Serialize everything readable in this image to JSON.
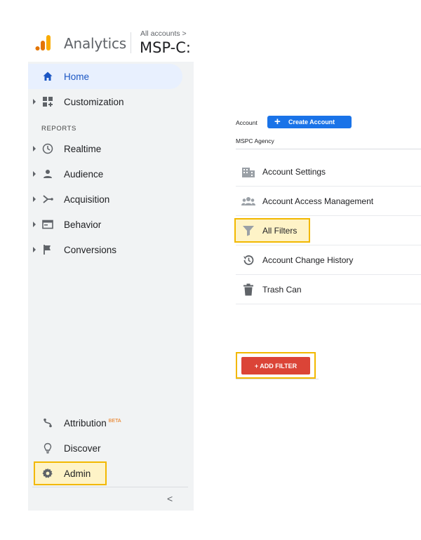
{
  "header": {
    "app_title": "Analytics",
    "breadcrumb": "All accounts >",
    "property_name": "MSP-C: I"
  },
  "sidebar": {
    "home": "Home",
    "customization": "Customization",
    "reports_section": "REPORTS",
    "realtime": "Realtime",
    "audience": "Audience",
    "acquisition": "Acquisition",
    "behavior": "Behavior",
    "conversions": "Conversions",
    "attribution": "Attribution",
    "attribution_badge": "BETA",
    "discover": "Discover",
    "admin": "Admin",
    "collapse_glyph": "<"
  },
  "admin": {
    "account_label": "Account",
    "create_account": "Create Account",
    "create_plus": "+",
    "account_value": "MSPC Agency",
    "menu": [
      {
        "label": "Account Settings",
        "icon": "building-icon"
      },
      {
        "label": "Account Access Management",
        "icon": "people-icon"
      },
      {
        "label": "All Filters",
        "icon": "funnel-icon"
      },
      {
        "label": "Account Change History",
        "icon": "history-icon"
      },
      {
        "label": "Trash Can",
        "icon": "trash-icon"
      }
    ],
    "add_filter": "+ ADD FILTER"
  },
  "colors": {
    "accent_blue": "#1a73e8",
    "home_active_bg": "#e8f0fe",
    "highlight_border": "#f2b800",
    "add_filter_red": "#db4437",
    "logo_orange": "#f9ab00",
    "logo_dark_orange": "#e37400"
  }
}
